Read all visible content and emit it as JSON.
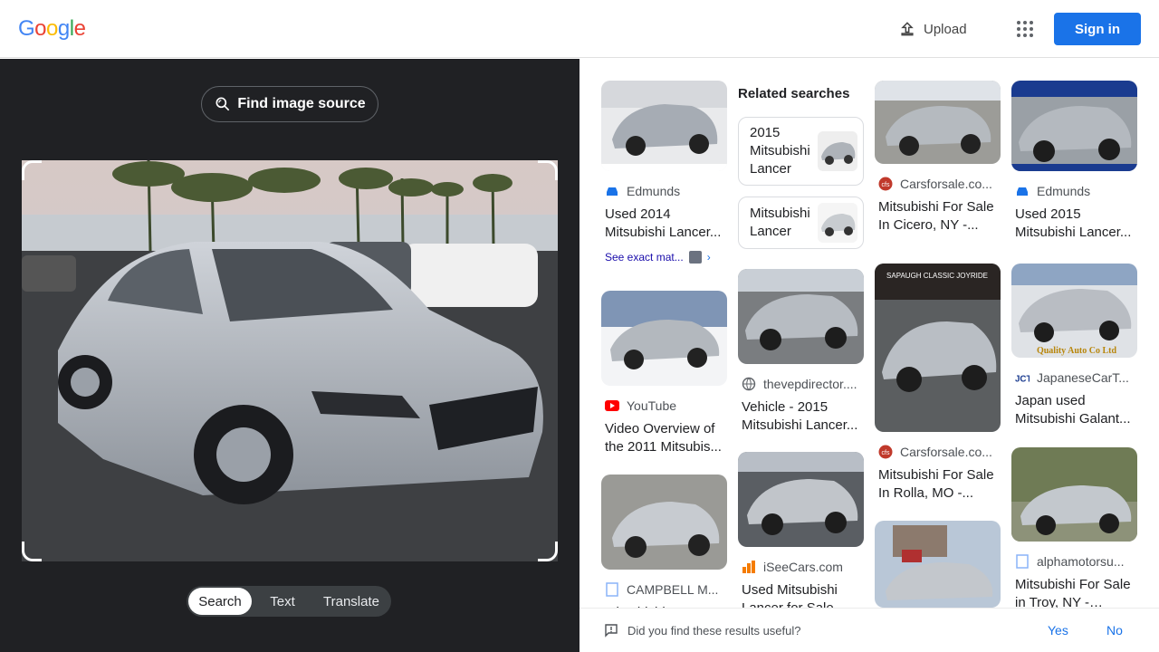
{
  "header": {
    "logo_letters": [
      {
        "char": "G",
        "color": "#4285f4"
      },
      {
        "char": "o",
        "color": "#ea4335"
      },
      {
        "char": "o",
        "color": "#fbbc05"
      },
      {
        "char": "g",
        "color": "#4285f4"
      },
      {
        "char": "l",
        "color": "#34a853"
      },
      {
        "char": "e",
        "color": "#ea4335"
      }
    ],
    "upload_label": "Upload",
    "apps_icon": "apps-grid-icon",
    "signin_label": "Sign in"
  },
  "left": {
    "find_source_label": "Find image source",
    "modes": [
      "Search",
      "Text",
      "Translate"
    ],
    "active_mode": "Search"
  },
  "results": {
    "related_title": "Related searches",
    "related": [
      {
        "text": "2015 Mitsubishi Lancer"
      },
      {
        "text": "Mitsubishi Lancer"
      }
    ],
    "see_exact": "See exact mat...",
    "cards": [
      {
        "source": "Edmunds",
        "title": "Used 2014 Mitsubishi Lancer...",
        "favicon": "car-icon"
      },
      {
        "source": "YouTube",
        "title": "Video Overview of the 2011 Mitsubis...",
        "favicon": "youtube-icon"
      },
      {
        "source": "CAMPBELL M...",
        "title": "Mitsubishi Lancer",
        "favicon": "page-icon"
      },
      {
        "source": "thevepdirector....",
        "title": "Vehicle - 2015 Mitsubishi Lancer...",
        "favicon": "globe-icon"
      },
      {
        "source": "iSeeCars.com",
        "title": "Used Mitsubishi Lancer for Sale",
        "favicon": "iseecars-icon"
      },
      {
        "source": "Carsforsale.co...",
        "title": "Mitsubishi For Sale In Cicero, NY -...",
        "favicon": "cfs-icon"
      },
      {
        "source": "Carsforsale.co...",
        "title": "Mitsubishi For Sale In Rolla, MO -...",
        "favicon": "cfs-icon"
      },
      {
        "source": "Edmunds",
        "title": "Used 2015 Mitsubishi Lancer...",
        "favicon": "car-icon"
      },
      {
        "source": "JapaneseCarT...",
        "title": "Japan used Mitsubishi Galant...",
        "favicon": "jct-icon"
      },
      {
        "source": "alphamotorsu...",
        "title": "Mitsubishi For Sale in Troy, NY - ALPH...",
        "favicon": "page-icon"
      }
    ],
    "overlay_text": {
      "sapaugh": "SAPAUGH CLASSIC JOYRIDE",
      "quality": "Quality Auto Co Ltd"
    }
  },
  "feedback": {
    "question": "Did you find these results useful?",
    "yes": "Yes",
    "no": "No"
  },
  "colors": {
    "accent": "#1a73e8",
    "dark_panel": "#202124",
    "car_silver": "#b9bec6"
  }
}
